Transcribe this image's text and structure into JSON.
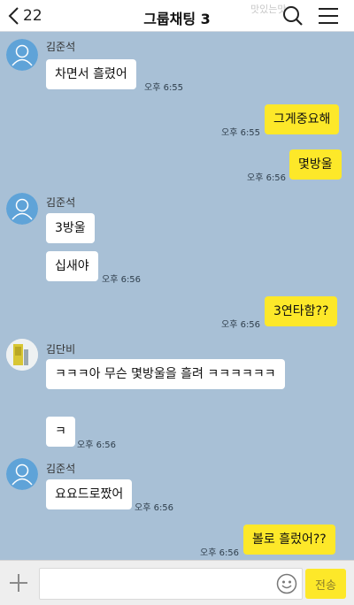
{
  "header": {
    "back_count": "22",
    "title": "그룹채팅 3",
    "notice": "맛있는맛"
  },
  "messages": [
    {
      "sender": "김준석",
      "text": "차면서 흘렸어",
      "time": "오후 6:55"
    },
    {
      "text": "그게중요해",
      "time": "오후 6:55"
    },
    {
      "text": "몇방울",
      "time": "오후 6:56"
    },
    {
      "sender": "김준석",
      "text": "3방울"
    },
    {
      "text": "십새야",
      "time": "오후 6:56"
    },
    {
      "text": "3연타함??",
      "time": "오후 6:56"
    },
    {
      "sender": "김단비",
      "text": "ㅋㅋㅋ아 무슨 몇방울을 흘려 ㅋㅋㅋㅋㅋㅋ"
    },
    {
      "text": "ㅋ",
      "time": "오후 6:56"
    },
    {
      "sender": "김준석",
      "text": "요요드로짰어",
      "time": "오후 6:56"
    },
    {
      "text": "볼로 흘렀어??",
      "time": "오후 6:56"
    }
  ],
  "input": {
    "send_label": "전송"
  },
  "colors": {
    "background": "#a8c0d6",
    "my_bubble": "#fde829",
    "their_bubble": "#ffffff"
  }
}
